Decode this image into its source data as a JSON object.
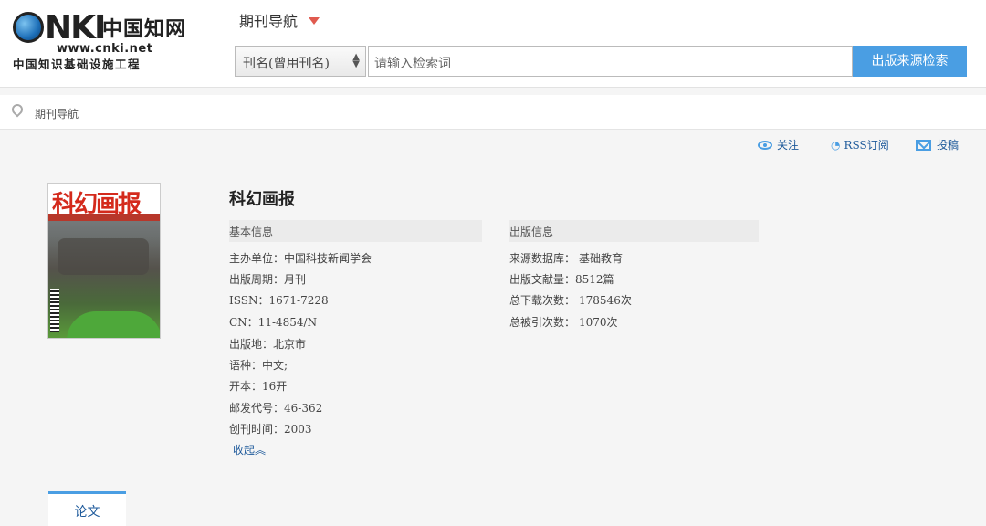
{
  "logo": {
    "brand": "NKI",
    "cn_name": "中国知网",
    "url": "www.cnki.net",
    "slogan": "中国知识基础设施工程"
  },
  "header": {
    "nav_title": "期刊导航"
  },
  "search": {
    "field_select": "刊名(曾用刊名)",
    "placeholder": "请输入检索词",
    "button": "出版来源检索"
  },
  "breadcrumb": {
    "text": "期刊导航"
  },
  "actions": {
    "follow": "关注",
    "rss": "RSS订阅",
    "submit": "投稿"
  },
  "journal": {
    "title": "科幻画报",
    "cover_title": "科幻画报",
    "basic_header": "基本信息",
    "publish_header": "出版信息",
    "basic": [
      {
        "label": "主办单位：",
        "value": "中国科技新闻学会"
      },
      {
        "label": "出版周期：",
        "value": "月刊"
      },
      {
        "label": "ISSN：",
        "value": "1671-7228"
      },
      {
        "label": "CN：",
        "value": "11-4854/N"
      },
      {
        "label": "出版地：",
        "value": "北京市"
      },
      {
        "label": "语种：",
        "value": "中文;"
      },
      {
        "label": "开本：",
        "value": "16开"
      },
      {
        "label": "邮发代号：",
        "value": "46-362"
      },
      {
        "label": "创刊时间：",
        "value": "2003"
      }
    ],
    "publish": [
      {
        "label": "来源数据库：",
        "value": "基础教育"
      },
      {
        "label": "出版文献量：",
        "value": "8512篇"
      },
      {
        "label": "总下载次数：",
        "value": "178546次"
      },
      {
        "label": "总被引次数：",
        "value": "1070次"
      }
    ],
    "collapse": "收起︽"
  },
  "tabs": [
    {
      "label": "论文"
    }
  ]
}
